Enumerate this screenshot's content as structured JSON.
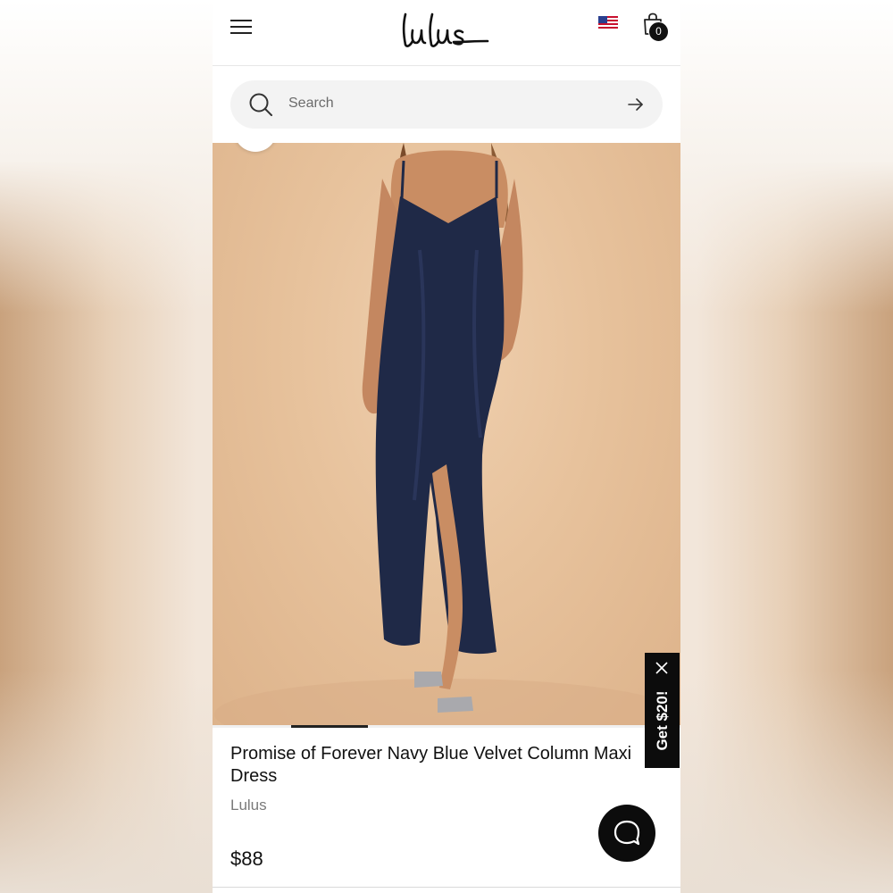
{
  "header": {
    "logo_text": "Lulus",
    "menu_icon": "hamburger-menu-icon",
    "flag_icon": "us-flag-icon",
    "bag_icon": "shopping-bag-icon",
    "bag_count": "0"
  },
  "search": {
    "placeholder": "Search",
    "search_icon": "search-icon",
    "submit_icon": "arrow-right-icon"
  },
  "product": {
    "title": "Promise of Forever Navy Blue Velvet Column Maxi Dress",
    "brand": "Lulus",
    "price": "$88",
    "dress_color": "#1c2540"
  },
  "promo": {
    "label": "Get $20!",
    "close_icon": "close-icon"
  },
  "chat": {
    "icon": "chat-bubble-icon"
  },
  "colors": {
    "photo_background": "#e7c29c",
    "accent_black": "#0c0c0c",
    "search_background": "#f3f3f3"
  }
}
